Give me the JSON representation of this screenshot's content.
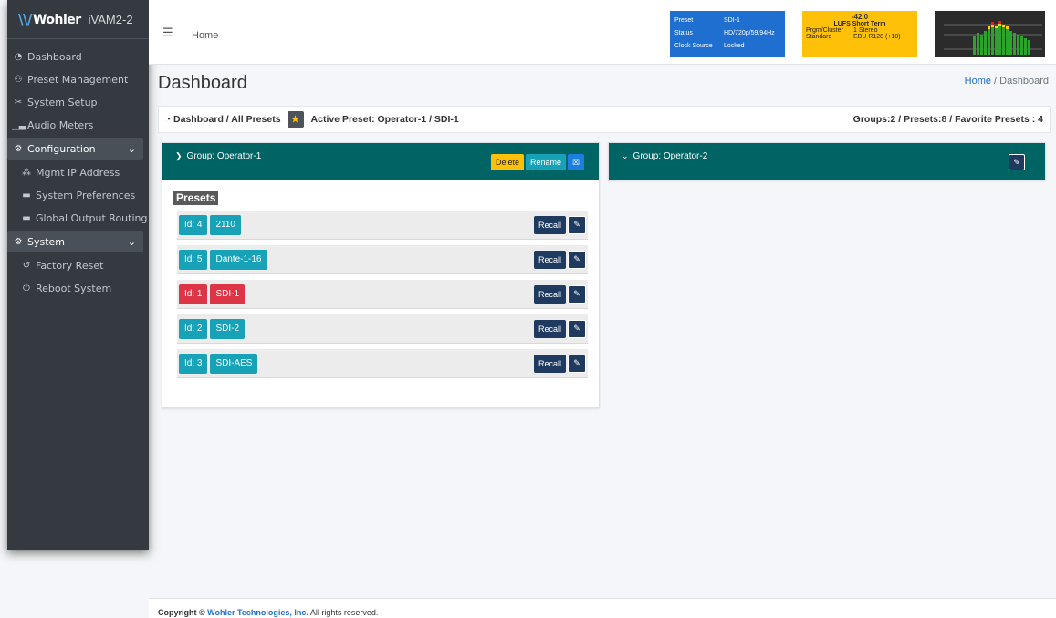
{
  "brand": {
    "logo": "Wohler",
    "product": "iVAM2-2"
  },
  "sidebar": {
    "items": [
      {
        "label": "Dashboard",
        "icon": "tachometer-icon"
      },
      {
        "label": "Preset Management",
        "icon": "user-gear-icon"
      },
      {
        "label": "System Setup",
        "icon": "tools-icon"
      },
      {
        "label": "Audio Meters",
        "icon": "chart-icon"
      }
    ],
    "config_section": "Configuration",
    "config_items": [
      "Mgmt IP Address",
      "System Preferences",
      "Global Output Routing"
    ],
    "system_section": "System",
    "system_items": [
      "Factory Reset",
      "Reboot System"
    ]
  },
  "topbar": {
    "home": "Home",
    "preset_box": {
      "preset_key": "Preset",
      "preset_val": "SDI-1",
      "status_key": "Status",
      "status_val": "HD/720p/59.94Hz",
      "clock_key": "Clock Source",
      "clock_val": "Locked"
    },
    "lufs_box": {
      "value": "-42.0",
      "label": "LUFS  Short Term",
      "cluster_key": "Prgm/Cluster",
      "cluster_val": "1  Stereo",
      "standard_key": "Standard",
      "standard_val": "EBU R128 (+18)"
    }
  },
  "page": {
    "title": "Dashboard",
    "crumb_home": "Home",
    "crumb_sep": "/",
    "crumb_current": "Dashboard"
  },
  "infobar": {
    "left": "Dashboard / All Presets",
    "active": "Active Preset: Operator-1 / SDI-1",
    "right": "Groups:2 / Presets:8 / Favorite Presets : 4"
  },
  "groups": [
    {
      "title": "Group: Operator-1",
      "delete_label": "Delete",
      "rename_label": "Rename",
      "presets_title": "Presets",
      "presets": [
        {
          "id": "Id: 4",
          "name": "2110",
          "recall": "Recall",
          "active": false
        },
        {
          "id": "Id: 5",
          "name": "Dante-1-16",
          "recall": "Recall",
          "active": false
        },
        {
          "id": "Id: 1",
          "name": "SDI-1",
          "recall": "Recall",
          "active": true
        },
        {
          "id": "Id: 2",
          "name": "SDI-2",
          "recall": "Recall",
          "active": false
        },
        {
          "id": "Id: 3",
          "name": "SDI-AES",
          "recall": "Recall",
          "active": false
        }
      ]
    },
    {
      "title": "Group: Operator-2"
    }
  ],
  "footer": {
    "copyright": "Copyright ©",
    "company": "Wohler Technologies, Inc.",
    "rights": "All rights reserved."
  },
  "colors": {
    "sidebar_bg": "#343a40",
    "group_header": "#006464",
    "preset_box": "#1f6fd0",
    "lufs_box": "#ffc107",
    "teal": "#17a2b8",
    "active_red": "#dc3545"
  }
}
